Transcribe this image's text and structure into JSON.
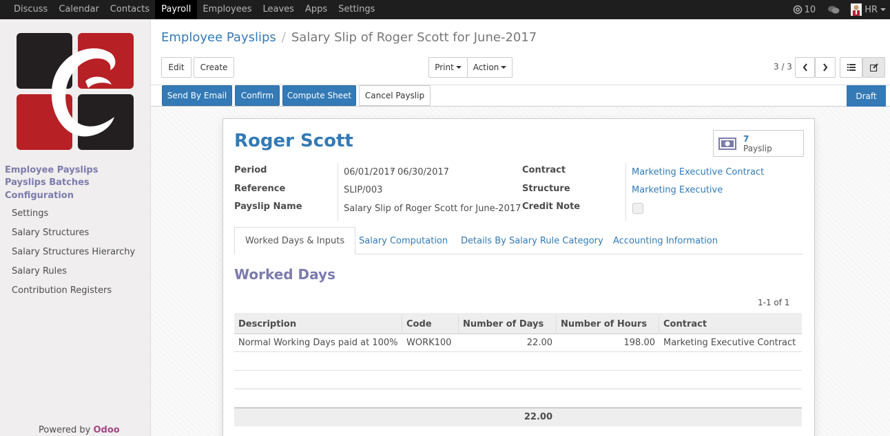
{
  "topbar": {
    "menu": [
      "Discuss",
      "Calendar",
      "Contacts",
      "Payroll",
      "Employees",
      "Leaves",
      "Apps",
      "Settings"
    ],
    "active": "Payroll",
    "mentions_count": "10",
    "user": "HR"
  },
  "sidebar": {
    "headers": [
      "Employee Payslips",
      "Payslips Batches",
      "Configuration"
    ],
    "items": [
      "Settings",
      "Salary Structures",
      "Salary Structures Hierarchy",
      "Salary Rules",
      "Contribution Registers"
    ],
    "powered_by": "Powered by",
    "powered_brand": "Odoo"
  },
  "breadcrumb": {
    "parent": "Employee Payslips",
    "separator": "/",
    "current": "Salary Slip of Roger Scott for June-2017"
  },
  "controls": {
    "edit": "Edit",
    "create": "Create",
    "print": "Print",
    "action": "Action",
    "pager": "3 / 3"
  },
  "statusbar": {
    "send_by_email": "Send By Email",
    "confirm": "Confirm",
    "compute_sheet": "Compute Sheet",
    "cancel_payslip": "Cancel Payslip",
    "state": "Draft"
  },
  "form": {
    "employee_name": "Roger Scott",
    "smart_button": {
      "count": "7",
      "label": "Payslip"
    },
    "fields_left": [
      {
        "label": "Period",
        "value_from": "06/01/2017",
        "dash": "-",
        "value_to": "06/30/2017"
      },
      {
        "label": "Reference",
        "value": "SLIP/003"
      },
      {
        "label": "Payslip Name",
        "value": "Salary Slip of Roger Scott for June-2017"
      }
    ],
    "fields_right": [
      {
        "label": "Contract",
        "value": "Marketing Executive Contract"
      },
      {
        "label": "Structure",
        "value": "Marketing Executive"
      },
      {
        "label": "Credit Note",
        "value": ""
      }
    ]
  },
  "tabs": [
    "Worked Days & Inputs",
    "Salary Computation",
    "Details By Salary Rule Category",
    "Accounting Information"
  ],
  "worked_days": {
    "title": "Worked Days",
    "pager": "1-1 of 1",
    "columns": [
      "Description",
      "Code",
      "Number of Days",
      "Number of Hours",
      "Contract"
    ],
    "rows": [
      [
        "Normal Working Days paid at 100%",
        "WORK100",
        "22.00",
        "198.00",
        "Marketing Executive Contract"
      ]
    ],
    "total_days": "22.00"
  }
}
